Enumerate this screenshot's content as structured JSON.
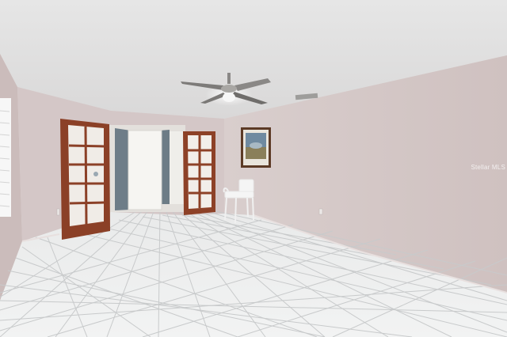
{
  "scene": {
    "description_key": "empty-room-with-tile-floor",
    "colors": {
      "ceiling": "#e4e3e2",
      "right_wall": "#d8cccb",
      "back_wall": "#d3c6c6",
      "left_wall": "#cdbfbe",
      "floor": "#ecedec",
      "floor_grout": "#c9cbcc",
      "door_wood": "#8a3f25",
      "door_glass": "#f1ede9",
      "hallway_wall": "#6d7c86"
    }
  },
  "watermark": {
    "text": "Stellar MLS"
  }
}
